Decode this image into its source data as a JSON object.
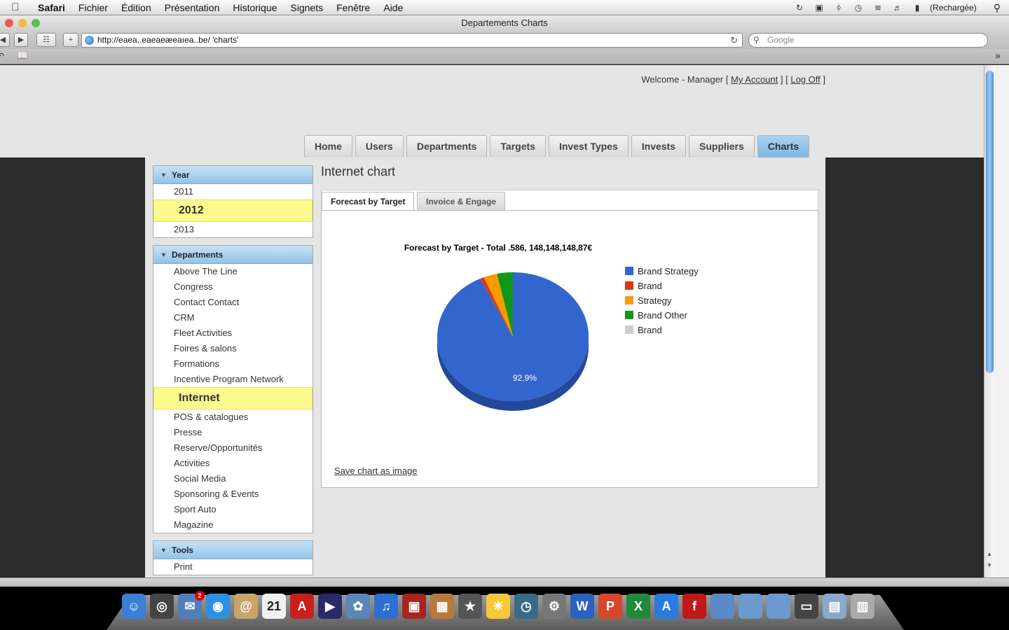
{
  "menubar": {
    "app": "Safari",
    "items": [
      "Fichier",
      "Édition",
      "Présentation",
      "Historique",
      "Signets",
      "Fenêtre",
      "Aide"
    ],
    "battery_status": "(Rechargée)"
  },
  "window": {
    "title": "Departements Charts",
    "url": "http://eaea..eaeaeæeaıea..be/   'charts'",
    "search_placeholder": "Google"
  },
  "header": {
    "welcome_prefix": "Welcome - Manager [",
    "my_account": "My Account",
    "mid": "] [",
    "log_off": "Log Off",
    "suffix": "]"
  },
  "nav": {
    "tabs": [
      "Home",
      "Users",
      "Departments",
      "Targets",
      "Invest Types",
      "Invests",
      "Suppliers",
      "Charts"
    ],
    "active": "Charts"
  },
  "sidebar": {
    "year": {
      "title": "Year",
      "items": [
        "2011",
        "2012",
        "2013"
      ],
      "selected": "2012"
    },
    "departments": {
      "title": "Departments",
      "items": [
        "Above The Line",
        "Congress",
        "Contact Contact",
        "CRM",
        "Fleet Activities",
        "Foires & salons",
        "Formations",
        "Incentive Program Network",
        "Internet",
        "POS & catalogues",
        "Presse",
        "Reserve/Opportunités",
        "Activities",
        "Social Media",
        "Sponsoring & Events",
        "Sport Auto",
        "Magazine"
      ],
      "selected": "Internet"
    },
    "tools": {
      "title": "Tools",
      "items": [
        "Print"
      ]
    }
  },
  "main": {
    "heading": "Internet chart",
    "tabs": [
      "Forecast by Target",
      "Invoice & Engage"
    ],
    "active_tab": "Forecast by Target",
    "save_link": "Save chart as image"
  },
  "chart_data": {
    "type": "pie",
    "title": "Forecast by Target - Total .586, 148,148,148,87€",
    "slice_label": "92.9%",
    "series": [
      {
        "name": "Brand Strategy",
        "value": 92.9,
        "color": "#3366cc"
      },
      {
        "name": "Brand",
        "value": 0.8,
        "color": "#dc3912"
      },
      {
        "name": "Strategy",
        "value": 2.9,
        "color": "#ff9900"
      },
      {
        "name": "Brand  Other",
        "value": 3.4,
        "color": "#109618"
      },
      {
        "name": "Brand",
        "value": 0,
        "color": "#cccccc"
      }
    ],
    "legend_position": "right"
  },
  "dock": {
    "icons": [
      "finder-icon",
      "dashboard-icon",
      "mail-icon",
      "safari-icon",
      "address-book-icon",
      "ical-icon",
      "acrobat-icon",
      "quicktime-icon",
      "iphoto-icon",
      "itunes-icon",
      "photo-booth-icon",
      "iphoto-library-icon",
      "imovie-icon",
      "cyberduck-icon",
      "time-machine-icon",
      "system-preferences-icon",
      "word-icon",
      "powerpoint-icon",
      "excel-icon",
      "app-store-icon",
      "flash-icon",
      "applications-folder-icon",
      "documents-folder-icon",
      "downloads-folder-icon",
      "screen-icon",
      "preview-icon",
      "trash-icon"
    ],
    "ical_day": "21",
    "mail_badge": "2"
  }
}
